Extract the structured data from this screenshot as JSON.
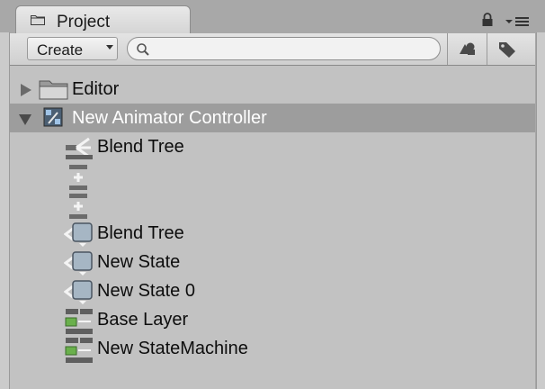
{
  "window": {
    "tab_title": "Project",
    "tab_icon": "folder-icon",
    "lock_icon": "lock-icon",
    "menu_icon": "menu-icon"
  },
  "toolbar": {
    "create_label": "Create",
    "search_placeholder": "",
    "search_value": "",
    "filter_by_type_icon": "filter-type-icon",
    "filter_by_label_icon": "tag-icon"
  },
  "tree": {
    "items": [
      {
        "label": "Editor",
        "icon": "folder-icon",
        "expanded": false
      },
      {
        "label": "New Animator Controller",
        "icon": "animator-controller-icon",
        "expanded": true,
        "selected": true
      },
      {
        "label": "Blend Tree",
        "icon": "blend-tree-icon"
      },
      {
        "label": "",
        "icon": "transition-icon"
      },
      {
        "label": "",
        "icon": "transition-icon"
      },
      {
        "label": "Blend Tree",
        "icon": "animator-state-icon"
      },
      {
        "label": "New State",
        "icon": "animator-state-icon"
      },
      {
        "label": "New State 0",
        "icon": "animator-state-icon"
      },
      {
        "label": "Base Layer",
        "icon": "state-machine-icon"
      },
      {
        "label": "New StateMachine",
        "icon": "state-machine-icon"
      }
    ]
  },
  "colors": {
    "selection": "#9d9d9d",
    "tree_background": "#c2c2c2",
    "toolbar_background": "#dadada"
  }
}
